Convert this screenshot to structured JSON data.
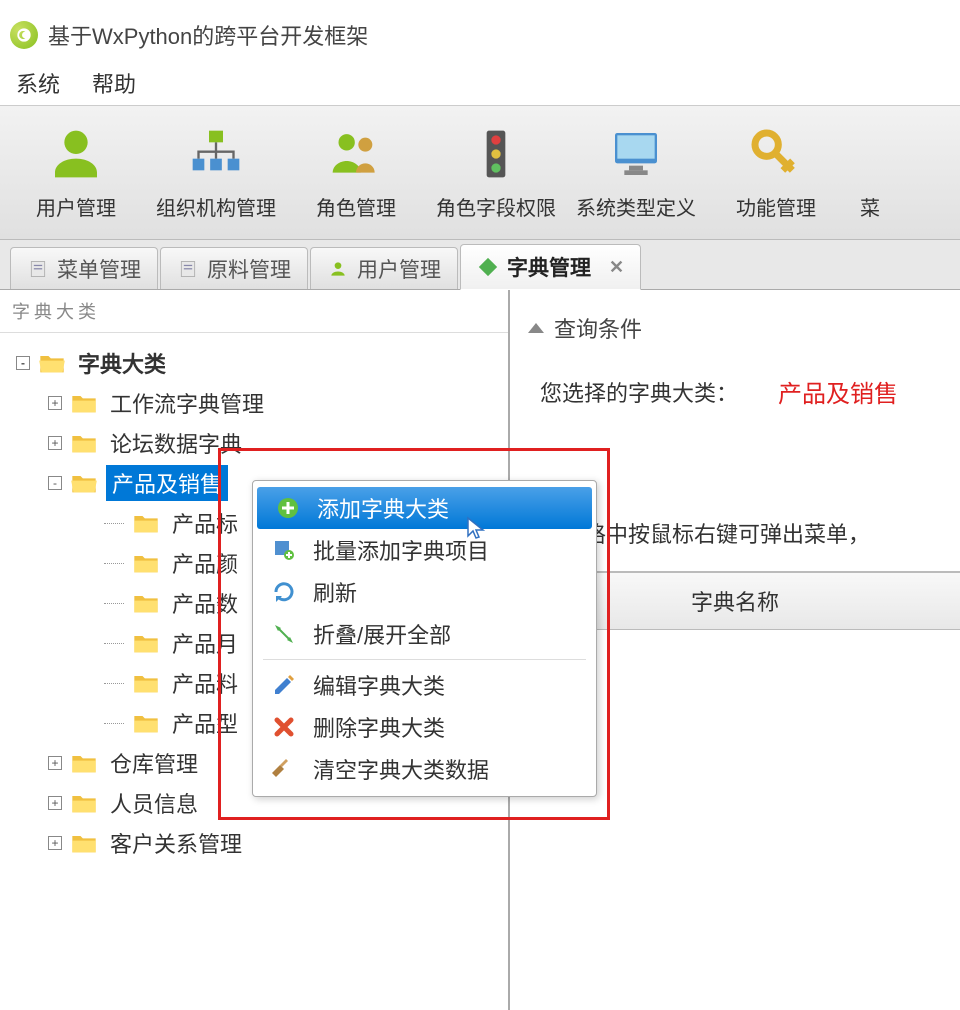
{
  "window": {
    "title": "基于WxPython的跨平台开发框架"
  },
  "menu": {
    "items": [
      "系统",
      "帮助"
    ]
  },
  "toolbar": {
    "items": [
      {
        "icon": "user",
        "label": "用户管理"
      },
      {
        "icon": "org",
        "label": "组织机构管理"
      },
      {
        "icon": "roles",
        "label": "角色管理"
      },
      {
        "icon": "perm",
        "label": "角色字段权限"
      },
      {
        "icon": "systype",
        "label": "系统类型定义"
      },
      {
        "icon": "key",
        "label": "功能管理"
      },
      {
        "icon": "menu",
        "label": "菜"
      }
    ]
  },
  "tabs": {
    "items": [
      {
        "icon": "doc",
        "label": "菜单管理",
        "active": false
      },
      {
        "icon": "doc",
        "label": "原料管理",
        "active": false
      },
      {
        "icon": "user",
        "label": "用户管理",
        "active": false
      },
      {
        "icon": "diamond",
        "label": "字典管理",
        "active": true,
        "closable": true
      }
    ]
  },
  "left_panel": {
    "title": "字典大类",
    "tree": {
      "root": "字典大类",
      "nodes": [
        {
          "label": "工作流字典管理",
          "expand": "+"
        },
        {
          "label": "论坛数据字典",
          "expand": "+"
        },
        {
          "label": "产品及销售",
          "expand": "-",
          "selected": true,
          "children": [
            {
              "label": "产品标"
            },
            {
              "label": "产品颜"
            },
            {
              "label": "产品数"
            },
            {
              "label": "产品月"
            },
            {
              "label": "产品料"
            },
            {
              "label": "产品型"
            }
          ]
        },
        {
          "label": "仓库管理",
          "expand": "+"
        },
        {
          "label": "人员信息",
          "expand": "+"
        },
        {
          "label": "客户关系管理",
          "expand": "+"
        }
      ]
    }
  },
  "context_menu": {
    "items": [
      {
        "icon": "add",
        "label": "添加字典大类",
        "hover": true
      },
      {
        "icon": "batch",
        "label": "批量添加字典项目"
      },
      {
        "icon": "refresh",
        "label": "刷新"
      },
      {
        "icon": "expand",
        "label": "折叠/展开全部"
      },
      {
        "sep": true
      },
      {
        "icon": "edit",
        "label": "编辑字典大类"
      },
      {
        "icon": "delete",
        "label": "删除字典大类"
      },
      {
        "icon": "clear",
        "label": "清空字典大类数据"
      }
    ]
  },
  "right_panel": {
    "collapse_title": "查询条件",
    "info_label": "您选择的字典大类：",
    "info_value": "产品及销售",
    "hint": "在表格中按鼠标右键可弹出菜单，",
    "table_header": "字典名称"
  }
}
